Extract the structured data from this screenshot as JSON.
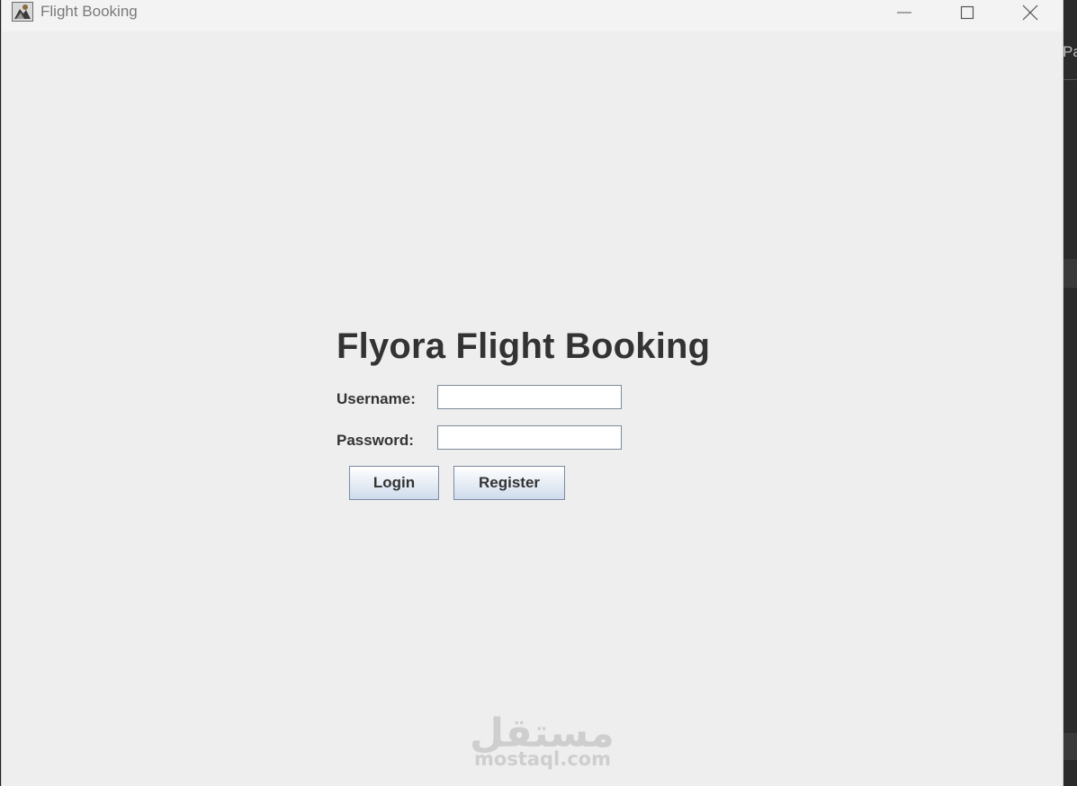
{
  "window": {
    "title": "Flight Booking",
    "icons": {
      "app": "java-app-icon",
      "minimize": "minimize-icon",
      "maximize": "maximize-icon",
      "close": "close-icon"
    }
  },
  "background": {
    "partial_tab_text": "Pa"
  },
  "login": {
    "heading": "Flyora Flight Booking",
    "username_label": "Username:",
    "username_value": "",
    "password_label": "Password:",
    "password_value": "",
    "login_button": "Login",
    "register_button": "Register"
  },
  "watermark": {
    "arabic": "مستقل",
    "latin": "mostaql.com"
  },
  "colors": {
    "window_bg": "#eeeeee",
    "titlebar_bg": "#f3f3f3",
    "text": "#333333",
    "button_gradient_bottom": "#cfdced",
    "button_border": "#7a8aa3"
  }
}
